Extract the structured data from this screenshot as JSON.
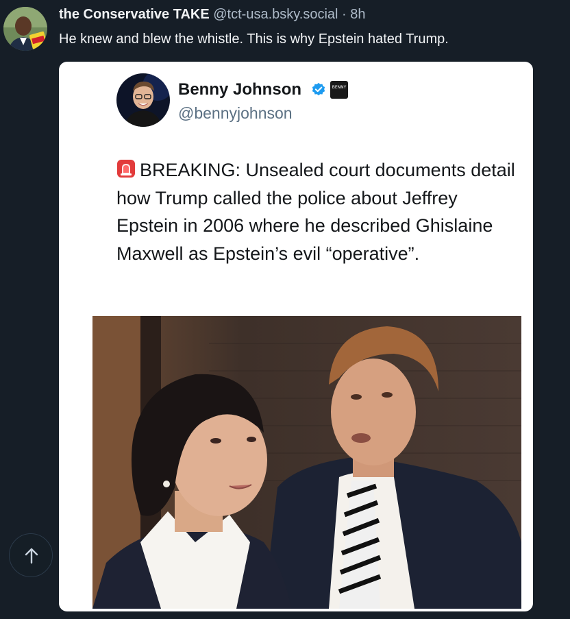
{
  "post": {
    "author_name": "the Conservative TAKE",
    "author_handle": "@tct-usa.bsky.social",
    "separator": "·",
    "time": "8h",
    "text": "He knew and blew the whistle. This is why Epstein hated Trump.",
    "avatar_icon": "user-avatar",
    "avatar_badge_text": "TAKE"
  },
  "embed": {
    "name": "Benny Johnson",
    "handle": "@bennyjohnson",
    "verified_icon": "verified-badge-icon",
    "org_badge_text": "BENNY",
    "alert_icon": "siren-emoji-icon",
    "body": "BREAKING: Unsealed court documents detail how Trump called the police about Jeffrey Epstein in 2006 where he described Ghislaine Maxwell as Epstein’s evil “operative”.",
    "photo": "photo of two people"
  },
  "controls": {
    "scroll_top_icon": "arrow-up-icon"
  },
  "colors": {
    "background": "#161e27",
    "text_primary": "#f1f3f5",
    "text_secondary": "#aebbc9",
    "verified_blue": "#1d9bf0"
  }
}
